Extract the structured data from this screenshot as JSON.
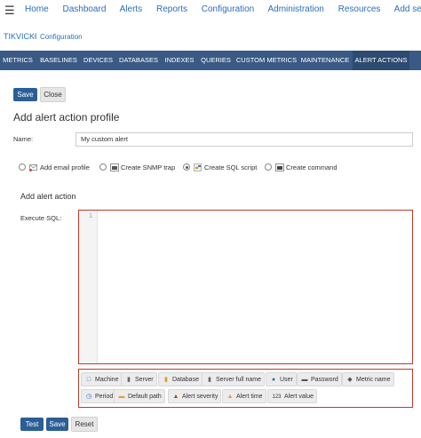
{
  "topnav": {
    "menu_icon": "hamburger-icon",
    "links": [
      "Home",
      "Dashboard",
      "Alerts",
      "Reports",
      "Configuration",
      "Administration",
      "Resources",
      "Add server"
    ]
  },
  "breadcrumb": {
    "server": "TIKVICKI",
    "page": "Configuration"
  },
  "tabs": [
    "METRICS",
    "BASELINES",
    "DEVICES",
    "DATABASES",
    "INDEXES",
    "QUERIES",
    "CUSTOM METRICS",
    "MAINTENANCE",
    "ALERT ACTIONS"
  ],
  "active_tab": "ALERT ACTIONS",
  "top_buttons": {
    "save": "Save",
    "close": "Close"
  },
  "form": {
    "title": "Add alert action profile",
    "name_label": "Name:",
    "name_value": "My custom alert"
  },
  "action_types": [
    {
      "label": "Add email profile",
      "icon": "email-icon",
      "selected": false
    },
    {
      "label": "Create SNMP trap",
      "icon": "snmp-icon",
      "selected": false
    },
    {
      "label": "Create SQL script",
      "icon": "sql-script-icon",
      "selected": true
    },
    {
      "label": "Create command",
      "icon": "command-icon",
      "selected": false
    }
  ],
  "alert_action": {
    "section_title": "Add alert action",
    "execute_label": "Execute SQL:",
    "line_number": "1"
  },
  "variables": [
    {
      "label": "Machine",
      "icon": "monitor-icon"
    },
    {
      "label": "Server",
      "icon": "server-icon"
    },
    {
      "label": "Database",
      "icon": "database-icon"
    },
    {
      "label": "Server full name",
      "icon": "server-icon"
    },
    {
      "label": "User",
      "icon": "user-icon"
    },
    {
      "label": "Password",
      "icon": "password-icon"
    },
    {
      "label": "Metric name",
      "icon": "tag-icon"
    },
    {
      "label": "Period",
      "icon": "clock-icon"
    },
    {
      "label": "Default path",
      "icon": "folder-icon"
    },
    {
      "label": "Alert severity",
      "icon": "warning-icon"
    },
    {
      "label": "Alert time",
      "icon": "alert-time-icon"
    },
    {
      "label": "Alert value",
      "icon": "number-icon",
      "icon_text": "123"
    }
  ],
  "bottom_buttons": {
    "test": "Test",
    "save": "Save",
    "reset": "Reset"
  },
  "colors": {
    "nav_bar": "#3a5a85",
    "primary_button": "#2b5e96",
    "link": "#2a6ebb",
    "highlight_border": "#c0392b"
  }
}
